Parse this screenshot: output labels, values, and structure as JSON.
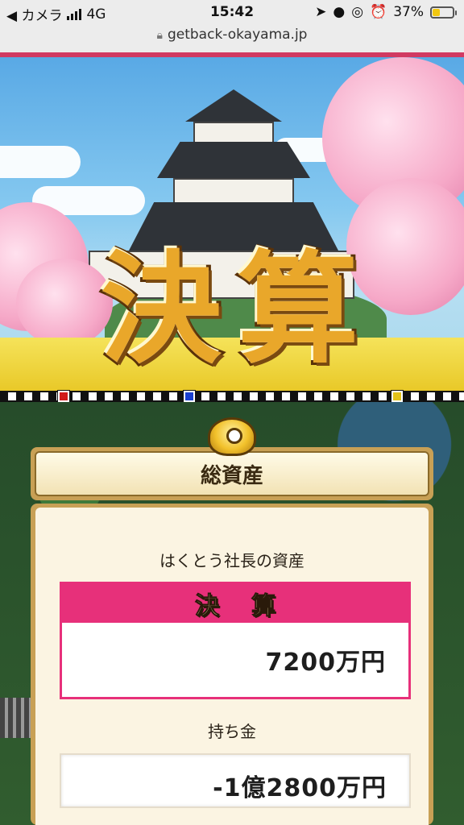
{
  "status_bar": {
    "back_label": "◀ カメラ",
    "network": "4G",
    "time": "15:42",
    "battery_percent": 37,
    "battery_label": "37%",
    "icons": [
      "location-icon",
      "person-icon",
      "rotation-lock-icon",
      "alarm-icon"
    ]
  },
  "url_bar": {
    "url": "getback-okayama.jp"
  },
  "banner": {
    "logo_text": [
      "決",
      "算"
    ]
  },
  "panel": {
    "title": "総資産",
    "owner_label": "はくとう社長の資産",
    "kessan_header": [
      "決",
      "算"
    ],
    "kessan_amount": "7200万円",
    "cash_label": "持ち金",
    "cash_amount": "-1億2800万円"
  },
  "colors": {
    "accent_pink": "#e7307a",
    "accent_line": "#d13a62",
    "panel_frame": "#c8a055",
    "battery_fill": "#f2c811"
  },
  "markers": [
    "#d11a1a",
    "#1a3fd1",
    "#e3c21a"
  ]
}
